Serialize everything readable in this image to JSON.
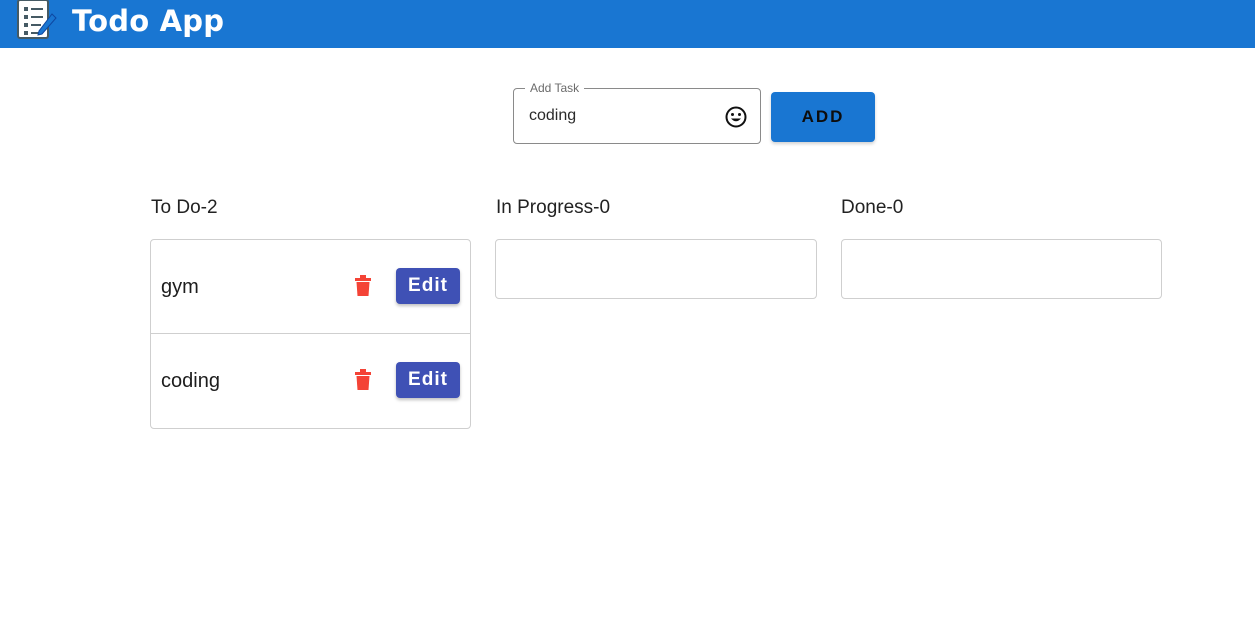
{
  "app": {
    "title": "Todo App",
    "header_color": "#1976d2",
    "logo_icon": "notepad-pen-icon"
  },
  "add_task": {
    "label": "Add Task",
    "value": "coding",
    "emoji_icon": "smiley-icon",
    "button_label": "ADD"
  },
  "columns": [
    {
      "title": "To Do-2",
      "tasks": [
        {
          "text": "gym",
          "edit_label": "Edit",
          "delete_icon": "trash-icon"
        },
        {
          "text": "coding",
          "edit_label": "Edit",
          "delete_icon": "trash-icon"
        }
      ]
    },
    {
      "title": "In Progress-0",
      "tasks": []
    },
    {
      "title": "Done-0",
      "tasks": []
    }
  ],
  "colors": {
    "primary": "#1976d2",
    "edit_button": "#3f51b5",
    "delete": "#f44336"
  }
}
